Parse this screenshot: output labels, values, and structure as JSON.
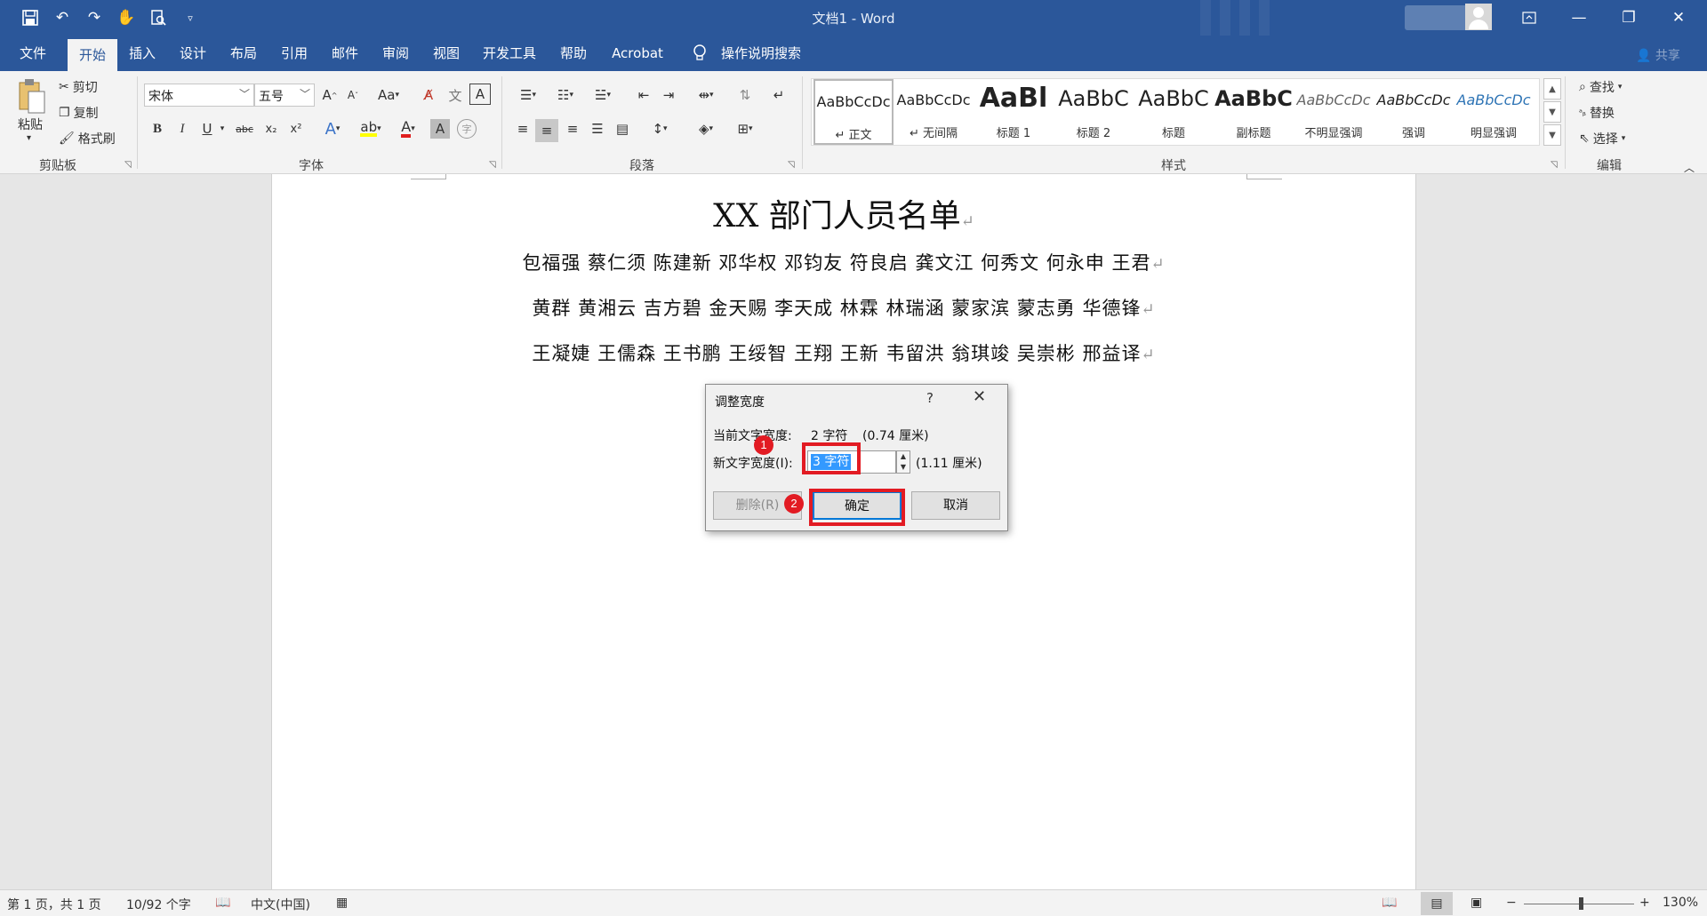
{
  "window": {
    "title": "文档1 - Word"
  },
  "qat": {
    "icons": [
      "save-icon",
      "undo-icon",
      "redo-icon",
      "touch-mode-icon",
      "print-preview-icon",
      "customize-qat-icon"
    ]
  },
  "menu": {
    "tabs": [
      "文件",
      "开始",
      "插入",
      "设计",
      "布局",
      "引用",
      "邮件",
      "审阅",
      "视图",
      "开发工具",
      "帮助",
      "Acrobat"
    ],
    "active": "开始",
    "tell_me": "操作说明搜索",
    "share": "共享"
  },
  "ribbon": {
    "clipboard": {
      "label": "剪贴板",
      "paste": "粘贴",
      "cut": "剪切",
      "copy": "复制",
      "format_painter": "格式刷"
    },
    "font": {
      "label": "字体",
      "name": "宋体",
      "size": "五号",
      "change_case": "Aa"
    },
    "paragraph": {
      "label": "段落"
    },
    "styles": {
      "label": "样式",
      "items": [
        {
          "sample": "AaBbCcDc",
          "name": "↵ 正文"
        },
        {
          "sample": "AaBbCcDc",
          "name": "↵ 无间隔"
        },
        {
          "sample": "AaBl",
          "name": "标题 1"
        },
        {
          "sample": "AaBbC",
          "name": "标题 2"
        },
        {
          "sample": "AaBbC",
          "name": "标题"
        },
        {
          "sample": "AaBbC",
          "name": "副标题"
        },
        {
          "sample": "AaBbCcDc",
          "name": "不明显强调"
        },
        {
          "sample": "AaBbCcDc",
          "name": "强调"
        },
        {
          "sample": "AaBbCcDc",
          "name": "明显强调"
        }
      ]
    },
    "editing": {
      "label": "编辑",
      "find": "查找",
      "replace": "替换",
      "select": "选择"
    }
  },
  "document": {
    "title": "XX 部门人员名单",
    "lines": [
      "包福强 蔡仁须 陈建新 邓华权 邓钧友 符良启 龚文江 何秀文 何永申 王君",
      "黄群 黄湘云 吉方碧 金天赐 李天成 林霖 林瑞涵 蒙家滨 蒙志勇 华德锋",
      "王凝婕 王儒森 王书鹏 王绥智 王翔 王新 韦留洪 翁琪竣 吴崇彬 邢益译"
    ],
    "para_mark": "↵"
  },
  "dialog": {
    "title": "调整宽度",
    "help": "?",
    "current_label": "当前文字宽度:",
    "current_value": "2 字符",
    "current_cm": "(0.74 厘米)",
    "new_label": "新文字宽度(I):",
    "new_value": "3 字符",
    "new_cm": "(1.11 厘米)",
    "delete_btn": "删除(R)",
    "ok_btn": "确定",
    "cancel_btn": "取消",
    "steps": [
      "1",
      "2"
    ]
  },
  "status": {
    "page": "第 1 页，共 1 页",
    "words": "10/92 个字",
    "language": "中文(中国)",
    "zoom": "130%"
  },
  "colors": {
    "accent": "#2b579a",
    "highlight": "#e21b23",
    "selection": "#3399ff"
  }
}
